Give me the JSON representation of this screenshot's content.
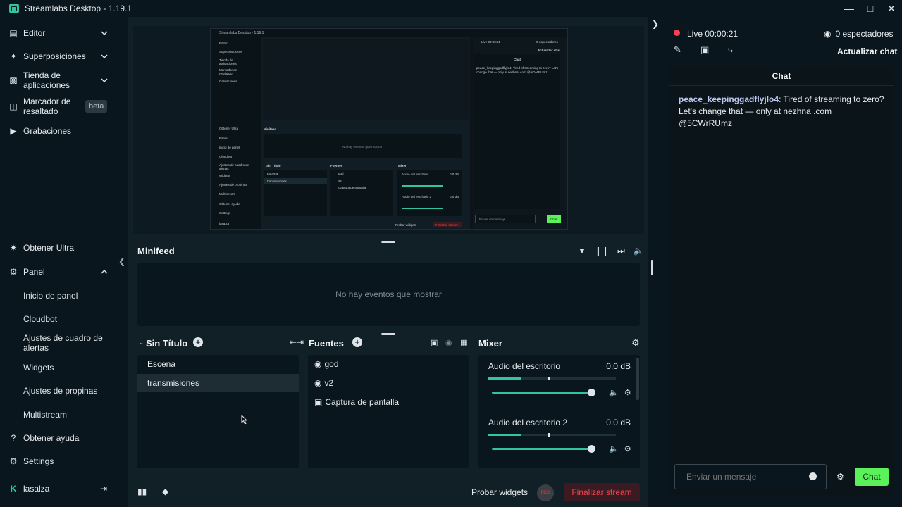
{
  "window": {
    "title": "Streamlabs Desktop - 1.19.1"
  },
  "sidebar": {
    "top_items": [
      {
        "label": "Editor"
      },
      {
        "label": "Superposiciones"
      },
      {
        "label": "Tienda de\naplicaciones"
      },
      {
        "label": "Marcador de\nresaltado",
        "badge": "beta"
      },
      {
        "label": "Grabaciones"
      }
    ],
    "bottom_items": {
      "ultra": "Obtener Ultra",
      "panel": "Panel",
      "panel_sub": [
        "Inicio de panel",
        "Cloudbot",
        "Ajustes de cuadro de\nalertas",
        "Widgets",
        "Ajustes de propinas",
        "Multistream"
      ],
      "help": "Obtener ayuda",
      "settings": "Settings",
      "user": "lasalza"
    }
  },
  "minipreview": {
    "title": "Streamlabs Desktop - 1.19.1",
    "side": [
      "Editor",
      "Superposiciones",
      "Tienda de aplicaciones",
      "Marcador de resaltado",
      "Grabaciones",
      "Obtener Ultra",
      "Panel",
      "Inicio de panel",
      "Cloudbot",
      "Ajustes de cuadro de alertas",
      "Widgets",
      "Ajustes de propinas",
      "Multistream",
      "Obtener ayuda",
      "Settings",
      "lasalza"
    ],
    "live": "Live 00:00:21",
    "viewers": "0 espectadores",
    "update": "Actualizar chat",
    "chat_head": "Chat",
    "chat_msg": "peace_keepinggadflyjlo4: Tired of streaming to zero? Let's change that — only at nezhna .com @5CWrRUmz",
    "minifeed": "Minifeed",
    "no_events": "No hay eventos que mostrar",
    "scene_title": "Sin Título",
    "scenes": [
      "Escena",
      "transmisiones"
    ],
    "sources_title": "Fuentes",
    "sources": [
      "god",
      "v2",
      "Captura de pantalla"
    ],
    "mixer_title": "Mixer",
    "mixer": [
      "Audio del escritorio",
      "Audio del escritorio 2"
    ],
    "db": "0.0 dB",
    "probar": "Probar widgets",
    "finalizar": "Finalizar stream",
    "input": "Enviar un mensaje",
    "send": "Chat"
  },
  "minifeed": {
    "title": "Minifeed",
    "empty": "No hay eventos que mostrar"
  },
  "scenes": {
    "title": "Sin Título",
    "items": [
      "Escena",
      "transmisiones"
    ],
    "selected": "transmisiones"
  },
  "sources": {
    "title": "Fuentes",
    "items": [
      {
        "label": "god",
        "icon": "gamepad-icon"
      },
      {
        "label": "v2",
        "icon": "gamepad-icon"
      },
      {
        "label": "Captura de pantalla",
        "icon": "monitor-icon"
      }
    ]
  },
  "mixer": {
    "title": "Mixer",
    "channels": [
      {
        "label": "Audio del escritorio",
        "db": "0.0 dB",
        "level": 0.26,
        "fader": 1.0
      },
      {
        "label": "Audio del escritorio 2",
        "db": "0.0 dB",
        "level": 0.26,
        "fader": 1.0
      }
    ]
  },
  "footer": {
    "test_widgets": "Probar widgets",
    "rec": "REC",
    "end_stream": "Finalizar stream"
  },
  "chat": {
    "live": "Live 00:00:21",
    "viewers": "0 espectadores",
    "refresh": "Actualizar chat",
    "header": "Chat",
    "message_user": "peace_keepinggadflyjlo4",
    "message_text": ": Tired of streaming to zero? Let's change that — only at nezhna .com @5CWrRUmz",
    "input_placeholder": "Enviar un mensaje",
    "send_label": "Chat"
  },
  "colors": {
    "accent": "#31c3a2",
    "live": "#f1424f",
    "send": "#5af15a",
    "bg": "#09161d"
  }
}
